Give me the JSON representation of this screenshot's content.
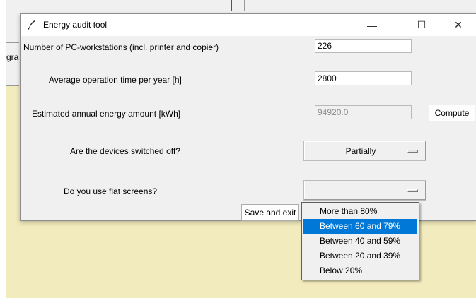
{
  "window": {
    "title": "Energy audit tool",
    "controls": {
      "minimize": "—",
      "maximize": "☐",
      "close": "✕"
    }
  },
  "background": {
    "left_text": "gra"
  },
  "fields": {
    "workstations": {
      "label": "Number of PC-workstations (incl. printer and copier)",
      "value": "226"
    },
    "operation_time": {
      "label": "Average operation time per year [h]",
      "value": "2800"
    },
    "energy_amount": {
      "label": "Estimated annual energy amount [kWh]",
      "value": "94920.0"
    }
  },
  "compute_label": "Compute",
  "switched_off": {
    "label": "Are the devices switched off?",
    "value": "Partially"
  },
  "flat_screens": {
    "label": "Do you use flat screens?",
    "value": "",
    "options": [
      "More than 80%",
      "Between 60 and 79%",
      "Between 40 and 59%",
      "Between 20 and 39%",
      "Below 20%"
    ],
    "highlighted": "Between 60 and 79%"
  },
  "save_exit_label": "Save and exit",
  "colors": {
    "accent": "#0078d7",
    "background_app": "#f2ebbd",
    "window": "#f0f0f0"
  }
}
